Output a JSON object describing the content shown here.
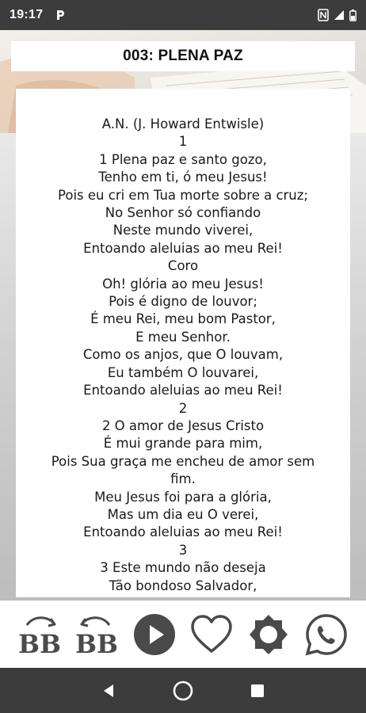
{
  "status_bar": {
    "time": "19:17",
    "icons": [
      "parking-icon",
      "nfc-icon",
      "signal-icon",
      "battery-icon"
    ]
  },
  "hymn": {
    "title": "003: PLENA PAZ",
    "lines": [
      "A.N. (J. Howard Entwisle)",
      "1",
      "1 Plena paz e santo gozo,",
      "Tenho em ti, ó meu Jesus!",
      "Pois eu cri em Tua morte sobre a cruz;",
      "No Senhor só confiando",
      "Neste mundo viverei,",
      "Entoando aleluias ao meu Rei!",
      "Coro",
      "Oh! glória ao meu Jesus!",
      "Pois é digno de louvor;",
      "É meu Rei, meu bom Pastor,",
      "E meu Senhor.",
      "Como os anjos, que O louvam,",
      "Eu também O louvarei,",
      "Entoando aleluias ao meu Rei!",
      "2",
      "2 O amor de Jesus Cristo",
      "É mui grande para mim,",
      "Pois Sua graça me encheu de amor sem",
      "fim.",
      "Meu Jesus foi para a glória,",
      "Mas um dia eu O verei,",
      "Entoando aleluias ao meu Rei!",
      "3",
      "3 Este mundo não deseja",
      "Tão bondoso Salvador,"
    ]
  },
  "toolbar": {
    "font_increase_label": "BB",
    "font_decrease_label": "BB",
    "icons": [
      "font-increase-icon",
      "font-decrease-icon",
      "play-icon",
      "heart-icon",
      "brightness-icon",
      "whatsapp-icon"
    ]
  },
  "nav_bar": {
    "icons": [
      "back-icon",
      "home-icon",
      "recents-icon"
    ]
  },
  "colors": {
    "status_bar_bg": "#3c3c3c",
    "nav_bar_bg": "#3c3c3c",
    "toolbar_icon": "#4a4a4a",
    "card_bg": "#ffffff"
  }
}
